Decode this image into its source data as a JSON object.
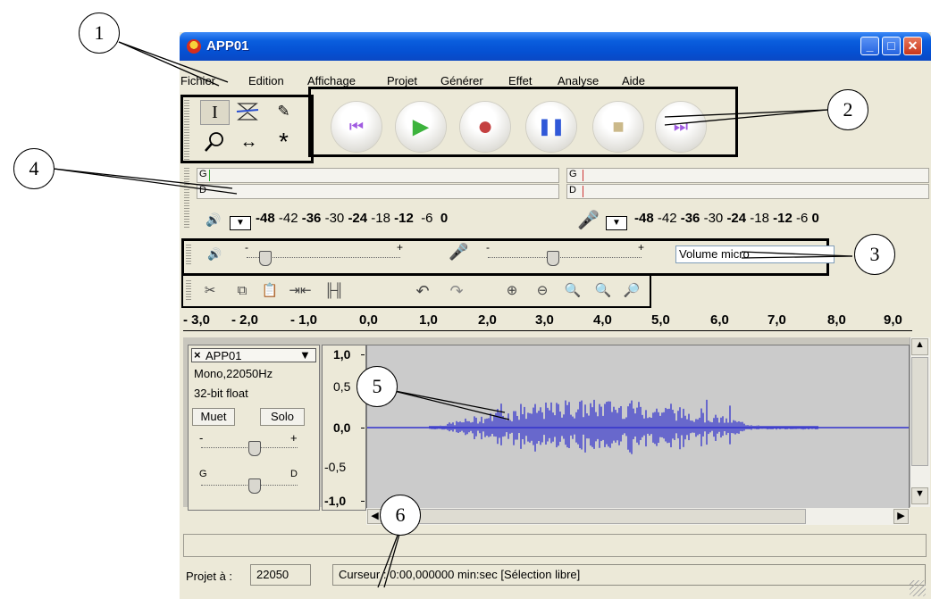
{
  "window": {
    "title": "APP01"
  },
  "menu": [
    "Fichier",
    "Edition",
    "Affichage",
    "Projet",
    "Générer",
    "Effet",
    "Analyse",
    "Aide"
  ],
  "meters": {
    "left_channel": "G",
    "right_channel": "D",
    "scale": [
      "-48",
      "-42",
      "-36",
      "-30",
      "-24",
      "-18",
      "-12",
      "-6",
      "0"
    ],
    "rec_scale": [
      "-48",
      "-42",
      "-36",
      "-30",
      "-24",
      "-18",
      "-12",
      "-6",
      "0"
    ]
  },
  "mixer": {
    "minus": "-",
    "plus": "+",
    "input_select": "Volume micro"
  },
  "ruler": [
    "- 3,0",
    "- 2,0",
    "- 1,0",
    "0,0",
    "1,0",
    "2,0",
    "3,0",
    "4,0",
    "5,0",
    "6,0",
    "7,0",
    "8,0",
    "9,0"
  ],
  "track": {
    "name": "APP01",
    "close": "×",
    "format": "Mono,22050Hz",
    "depth": "32-bit float",
    "mute": "Muet",
    "solo": "Solo",
    "gain_minus": "-",
    "gain_plus": "+",
    "pan_left": "G",
    "pan_right": "D",
    "scale": [
      "1,0",
      "0,5",
      "0,0",
      "-0,5",
      "-1,0"
    ]
  },
  "status": {
    "project_label": "Projet à :",
    "rate": "22050",
    "cursor": "Curseur : 0:00,000000 min:sec  [Sélection libre]"
  },
  "callouts": [
    "1",
    "2",
    "3",
    "4",
    "5",
    "6"
  ],
  "colors": {
    "waveform": "#3333cc",
    "titlebar": "#0a5ede",
    "window_bg": "#ece9d8"
  },
  "icons": [
    "select-tool-icon",
    "envelope-tool-icon",
    "pencil-tool-icon",
    "zoom-tool-icon",
    "timeshift-tool-icon",
    "multi-tool-icon",
    "skip-start-icon",
    "play-icon",
    "record-icon",
    "pause-icon",
    "stop-icon",
    "skip-end-icon",
    "speaker-icon",
    "microphone-icon",
    "cut-icon",
    "copy-icon",
    "paste-icon",
    "trim-icon",
    "silence-icon",
    "undo-icon",
    "redo-icon",
    "zoom-in-icon",
    "zoom-out-icon",
    "fit-selection-icon",
    "fit-project-icon"
  ]
}
